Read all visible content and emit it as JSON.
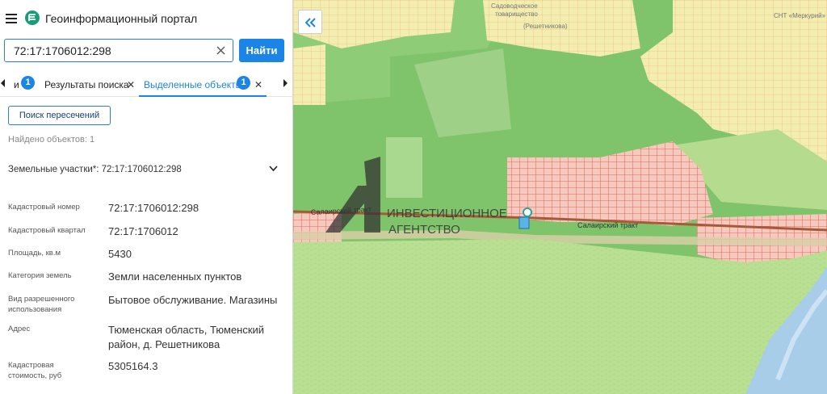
{
  "header": {
    "title": "Геоинформационный портал"
  },
  "search": {
    "value": "72:17:1706012:298",
    "button_label": "Найти"
  },
  "tabs": [
    {
      "label": "и",
      "badge": "1"
    },
    {
      "label": "Результаты поиска"
    },
    {
      "label": "Выделенные объекты",
      "badge": "1"
    }
  ],
  "actions": {
    "intersect_label": "Поиск пересечений"
  },
  "results": {
    "found_text": "Найдено объектов: 1",
    "group_title": "Земельные участки*: 72:17:1706012:298"
  },
  "attributes": [
    {
      "key": "Кадастровый номер",
      "value": "72:17:1706012:298"
    },
    {
      "key": "Кадастровый квартал",
      "value": "72:17:1706012"
    },
    {
      "key": "Площадь, кв.м",
      "value": "5430"
    },
    {
      "key": "Категория земель",
      "value": "Земли населенных пунктов"
    },
    {
      "key": "Вид разрешенного использования",
      "value": "Бытовое обслуживание. Магазины"
    },
    {
      "key": "Адрес",
      "value": "Тюменская область, Тюменский район, д. Решетникова"
    },
    {
      "key": "Кадастровая стоимость, руб",
      "value": "5305164.3"
    }
  ],
  "map": {
    "watermark_line1": "ИНВЕСТИЦИОННОЕ",
    "watermark_line2": "АГЕНТСТВО",
    "road_label_left": "Салаирский тракт",
    "road_label_right": "Салаирский тракт",
    "top_label_1": "Садоводческое",
    "top_label_2": "товарищество",
    "top_label_3": "(Решетникова)",
    "top_label_4": "СНТ «Меркурий»"
  },
  "colors": {
    "accent": "#1b84e7",
    "forest": "#7fc46a",
    "meadow": "#b5dc8e",
    "settlement": "#f3eeb0",
    "parcels_selected": "#f4b8b0",
    "river": "#a8cde9"
  }
}
